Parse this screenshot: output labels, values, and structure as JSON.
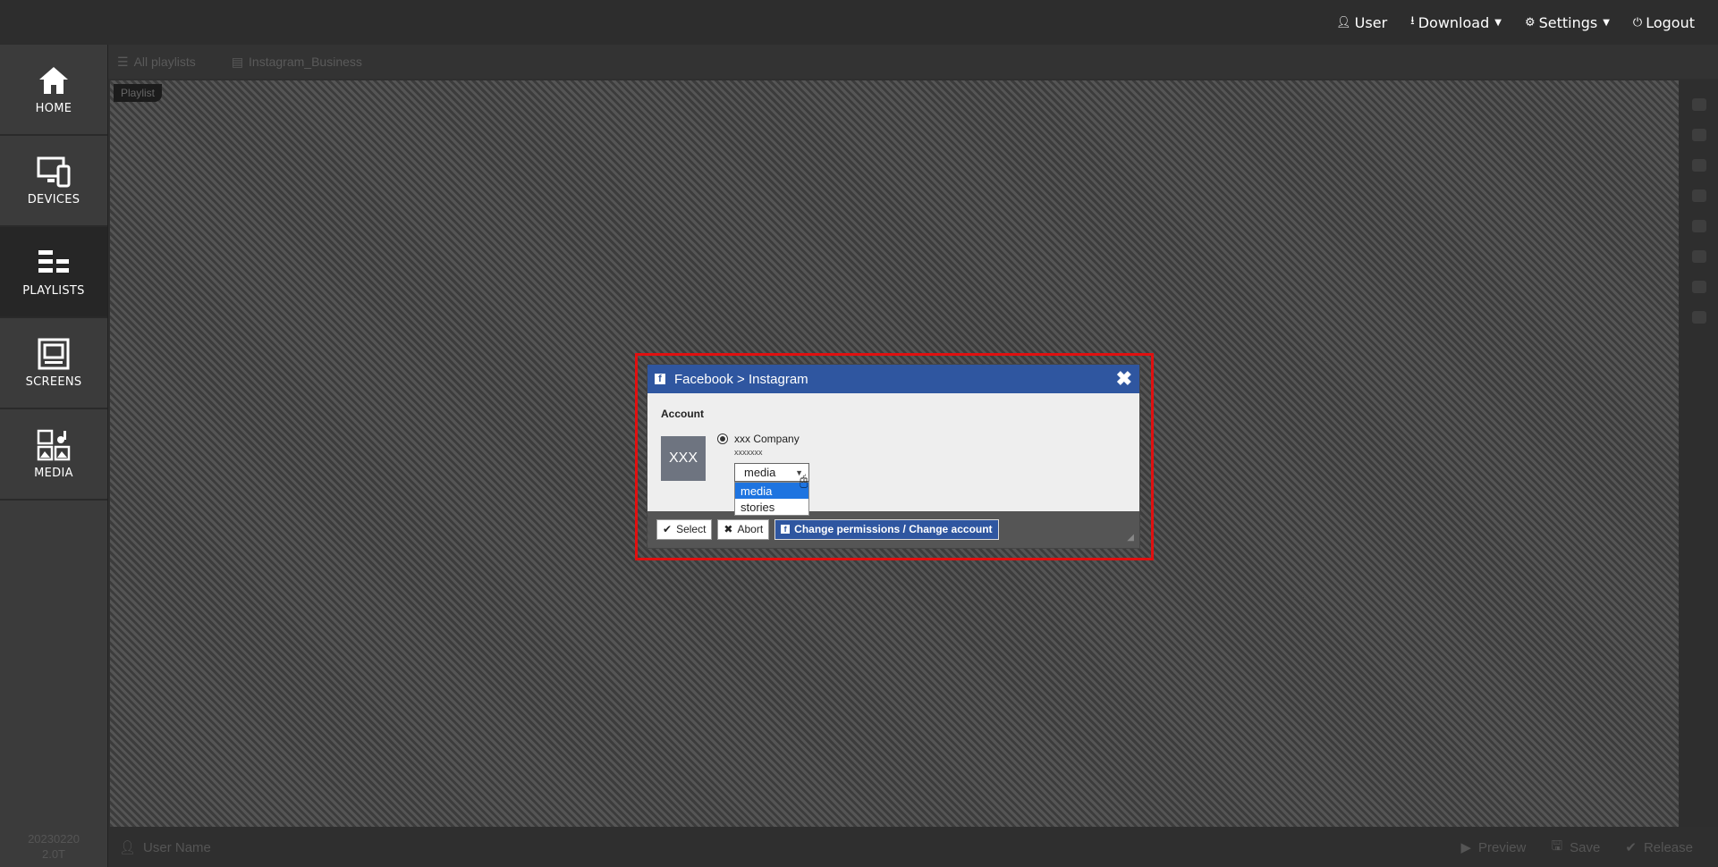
{
  "topbar": {
    "user_label": "User",
    "download_label": "Download",
    "settings_label": "Settings",
    "logout_label": "Logout"
  },
  "sidebar": {
    "items": [
      {
        "label": "HOME",
        "icon": "home-icon"
      },
      {
        "label": "DEVICES",
        "icon": "devices-icon"
      },
      {
        "label": "PLAYLISTS",
        "icon": "playlists-icon",
        "active": true
      },
      {
        "label": "SCREENS",
        "icon": "screens-icon"
      },
      {
        "label": "MEDIA",
        "icon": "media-icon"
      }
    ],
    "version_line1": "20230220",
    "version_line2": "2.0T"
  },
  "toolbar": {
    "all_playlists_label": "All playlists",
    "playlist_name": "Instagram_Business"
  },
  "canvas": {
    "playlist_tag": "Playlist"
  },
  "bottombar": {
    "user_name": "User Name",
    "preview_label": "Preview",
    "save_label": "Save",
    "release_label": "Release"
  },
  "dialog": {
    "title": "Facebook > Instagram",
    "account_label": "Account",
    "avatar_text": "XXX",
    "company_name": "xxx Company",
    "company_sub": "xxxxxxx",
    "selected_type": "media",
    "options": [
      "media",
      "stories"
    ],
    "select_button": "Select",
    "abort_button": "Abort",
    "change_button": "Change permissions / Change account"
  },
  "colors": {
    "dialog_title_bg": "#2f56a0",
    "highlight_border": "#e01010",
    "selected_option_bg": "#1e74e0"
  }
}
